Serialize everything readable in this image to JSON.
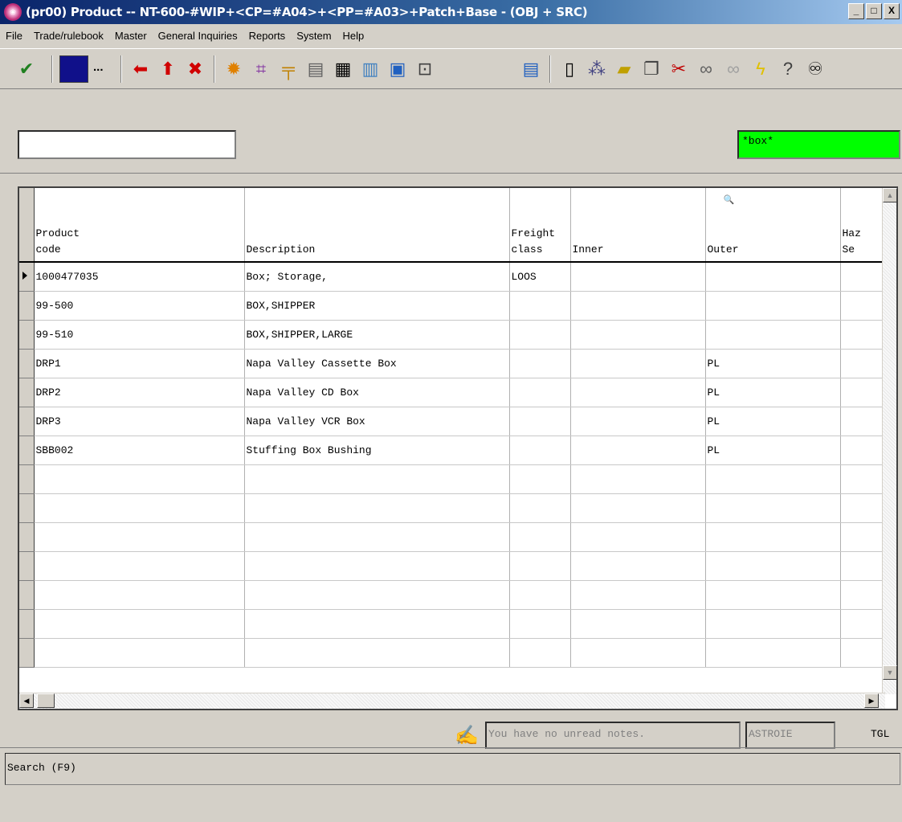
{
  "window": {
    "title": "(pr00) Product -- NT-600-#WIP+<CP=#A04>+<PP=#A03>+Patch+Base - (OBJ + SRC)",
    "minimize": "_",
    "restore": "□",
    "close": "X"
  },
  "menu": [
    "File",
    "Trade/rulebook",
    "Master",
    "General Inquiries",
    "Reports",
    "System",
    "Help"
  ],
  "toolbar": {
    "ok_icon": "✔",
    "dots": "...",
    "icons": [
      "red-arrow-left-icon",
      "red-arrow-up-icon",
      "red-x-icon",
      "fire-icon",
      "grid-icon",
      "ruler-icon",
      "document-icon",
      "table-edit-icon",
      "chart-icon",
      "image-icon",
      "preview-icon",
      "report-icon",
      "new-doc-icon",
      "tree-icon",
      "open-folder-icon",
      "copy-icon",
      "cut-icon",
      "find-icon",
      "find-next-icon",
      "lightning-icon",
      "help-icon",
      "binoculars-icon"
    ]
  },
  "search": {
    "value": "",
    "filter": "*box*"
  },
  "grid": {
    "columns": [
      "Product\ncode",
      "Description",
      "Freight\nclass",
      "Inner",
      "Outer",
      "Haz\nSe"
    ],
    "rows": [
      [
        "1000477035",
        "Box; Storage,",
        "LOOS",
        "",
        "",
        ""
      ],
      [
        "99-500",
        "BOX,SHIPPER",
        "",
        "",
        "",
        ""
      ],
      [
        "99-510",
        "BOX,SHIPPER,LARGE",
        "",
        "",
        "",
        ""
      ],
      [
        "DRP1",
        "Napa Valley Cassette Box",
        "",
        "",
        "PL",
        ""
      ],
      [
        "DRP2",
        "Napa Valley CD Box",
        "",
        "",
        "PL",
        ""
      ],
      [
        "DRP3",
        "Napa Valley VCR Box",
        "",
        "",
        "PL",
        ""
      ],
      [
        "SBB002",
        "Stuffing Box Bushing",
        "",
        "",
        "PL",
        ""
      ],
      [
        "",
        "",
        "",
        "",
        "",
        ""
      ],
      [
        "",
        "",
        "",
        "",
        "",
        ""
      ],
      [
        "",
        "",
        "",
        "",
        "",
        ""
      ],
      [
        "",
        "",
        "",
        "",
        "",
        ""
      ],
      [
        "",
        "",
        "",
        "",
        "",
        ""
      ],
      [
        "",
        "",
        "",
        "",
        "",
        ""
      ],
      [
        "",
        "",
        "",
        "",
        "",
        ""
      ]
    ]
  },
  "notes": {
    "message": "You have no unread notes.",
    "user": "ASTROIE",
    "tgl": "TGL"
  },
  "status": {
    "text": "Search (F9)"
  }
}
